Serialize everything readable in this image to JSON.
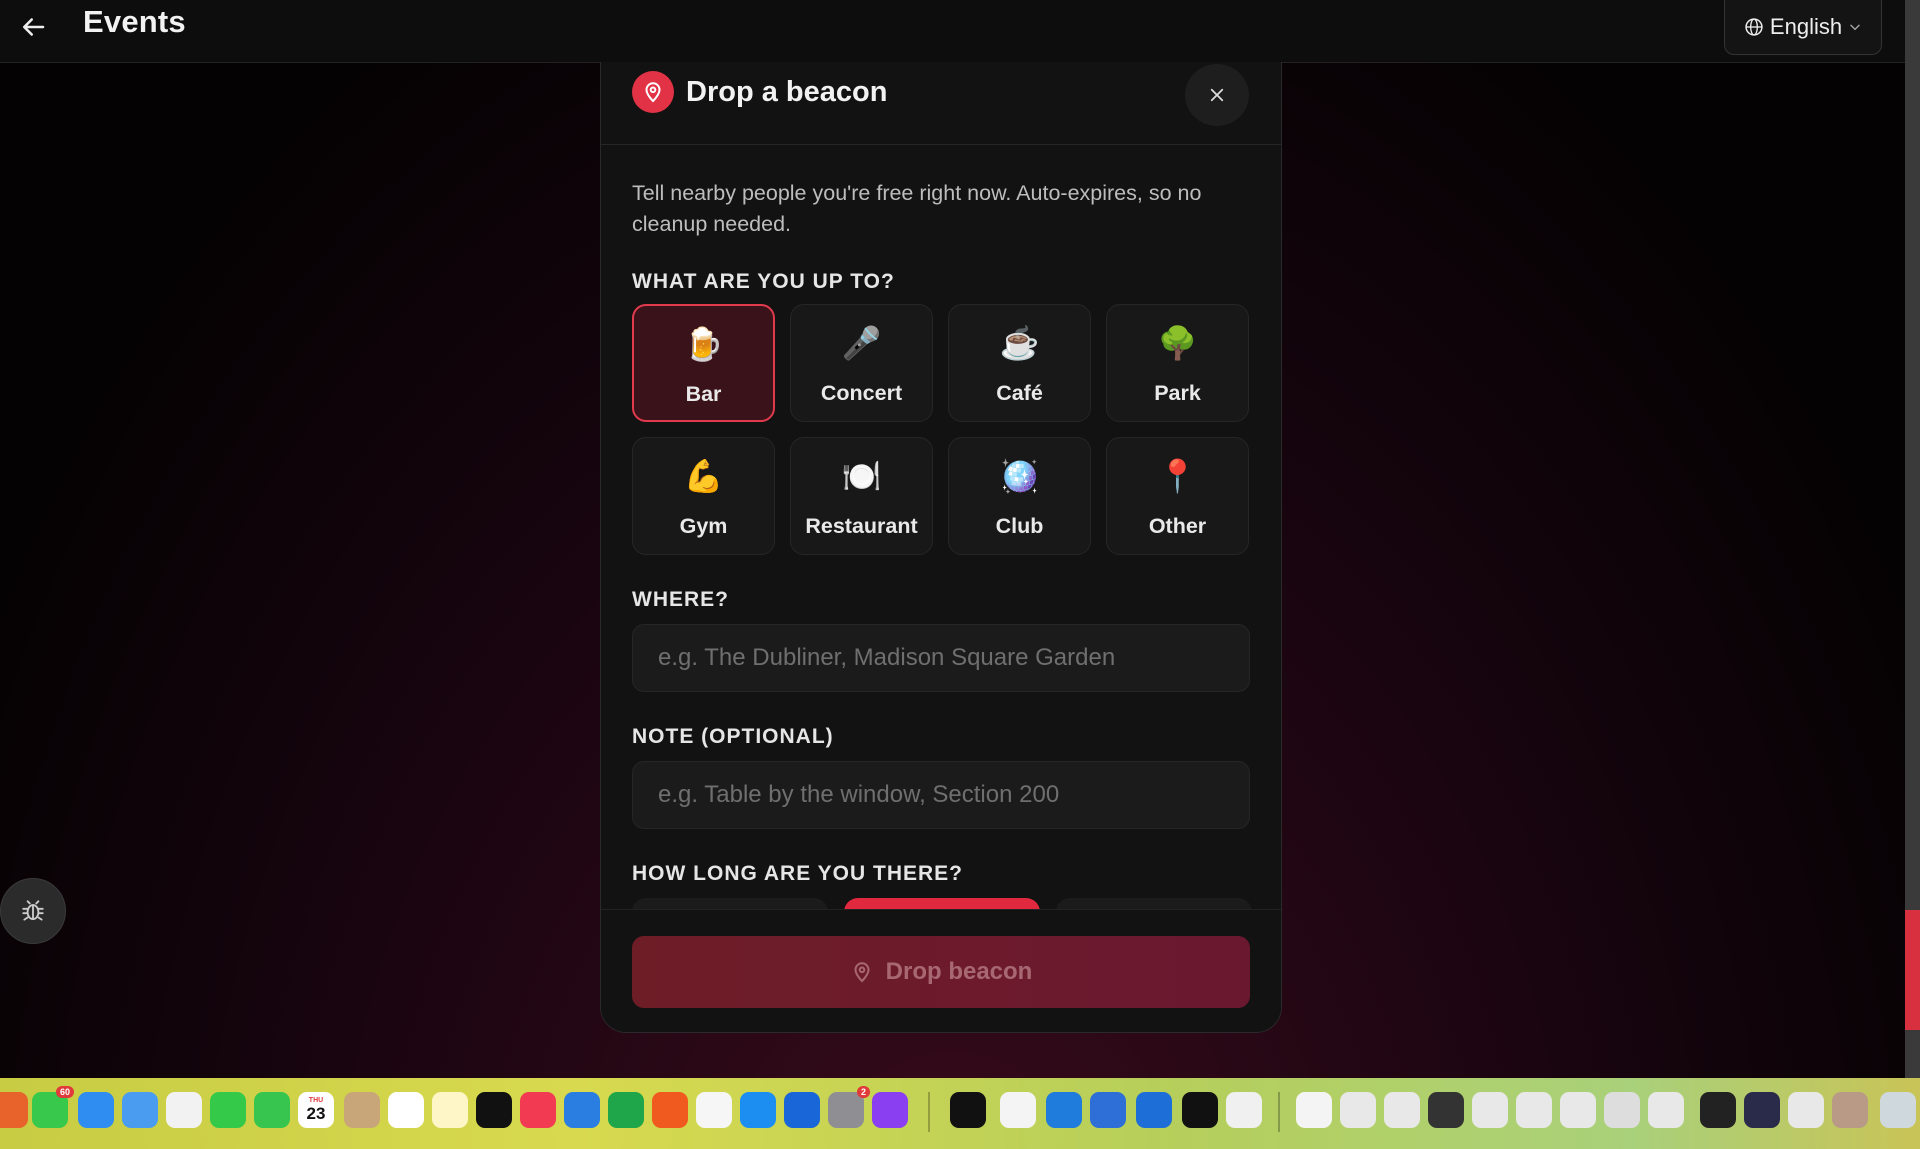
{
  "topbar": {
    "title": "Events",
    "language": "English"
  },
  "modal": {
    "title": "Drop a beacon",
    "intro": "Tell nearby people you're free right now. Auto-expires, so no cleanup needed.",
    "activity_label": "WHAT ARE YOU UP TO?",
    "activities": [
      {
        "label": "Bar",
        "emoji": "🍺",
        "selected": true
      },
      {
        "label": "Concert",
        "emoji": "🎤",
        "selected": false
      },
      {
        "label": "Café",
        "emoji": "☕",
        "selected": false
      },
      {
        "label": "Park",
        "emoji": "🌳",
        "selected": false
      },
      {
        "label": "Gym",
        "emoji": "💪",
        "selected": false
      },
      {
        "label": "Restaurant",
        "emoji": "🍽️",
        "selected": false
      },
      {
        "label": "Club",
        "emoji": "🪩",
        "selected": false
      },
      {
        "label": "Other",
        "emoji": "📍",
        "selected": false
      }
    ],
    "where_label": "WHERE?",
    "where_placeholder": "e.g. The Dubliner, Madison Square Garden",
    "where_value": "",
    "note_label": "NOTE (OPTIONAL)",
    "note_placeholder": "e.g. Table by the window, Section 200",
    "note_value": "",
    "duration_label": "HOW LONG ARE YOU THERE?",
    "submit_label": "Drop beacon"
  },
  "dock": {
    "calendar_day": "23",
    "calendar_month": "THU",
    "messages_badge": "60",
    "settings_badge": "2"
  },
  "colors": {
    "accent": "#e23346",
    "selected_border": "#e13a4d",
    "button_bg": "#6e1d27",
    "dock_bg": "#d8d94e"
  }
}
